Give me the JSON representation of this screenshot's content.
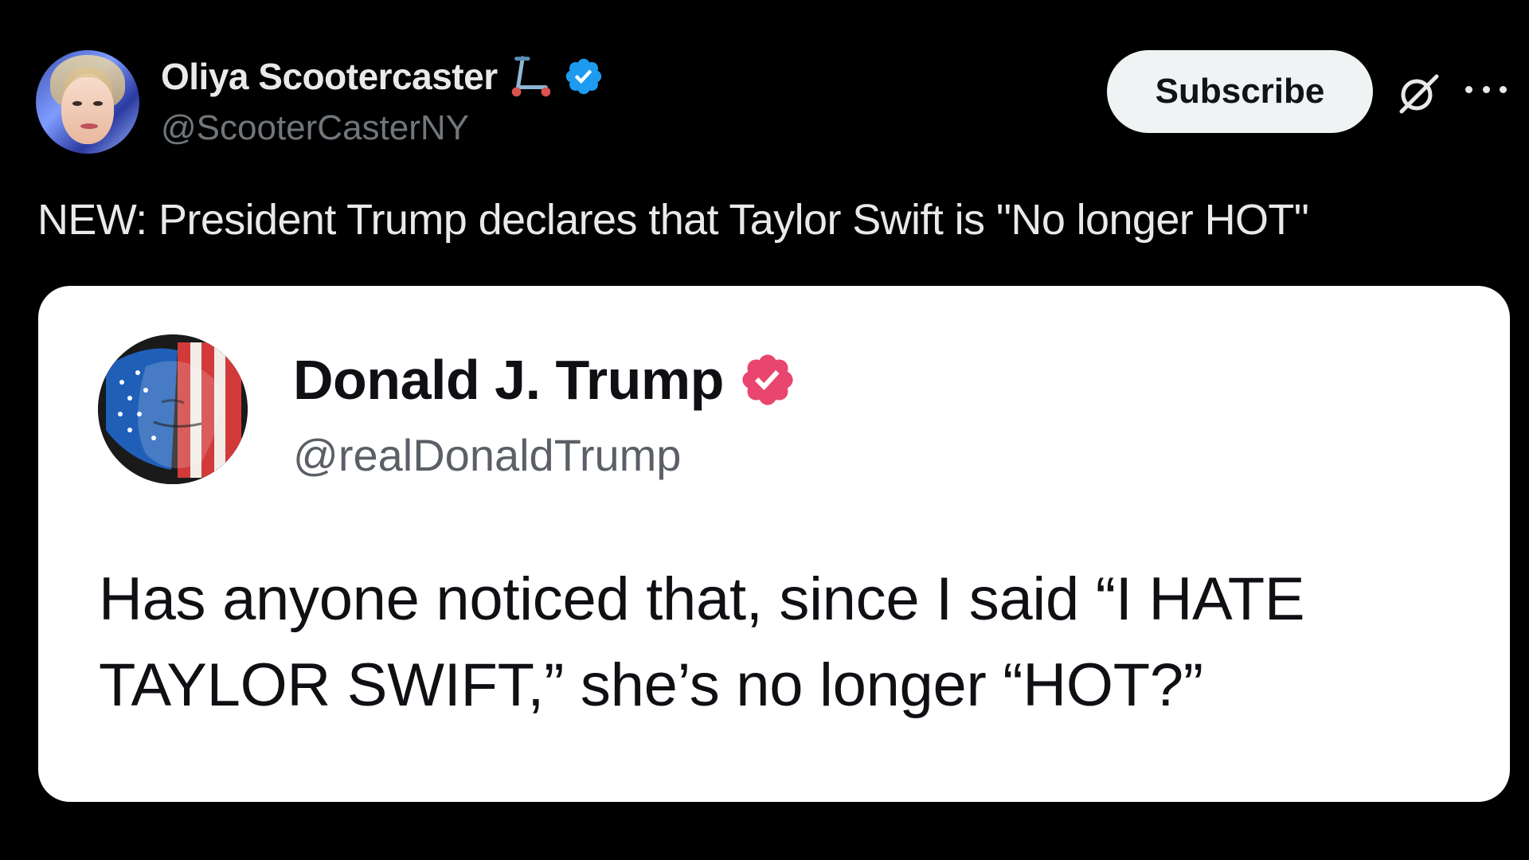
{
  "tweet": {
    "author": {
      "display_name": "Oliya Scootercaster",
      "handle": "@ScooterCasterNY",
      "emoji_icon": "kick-scooter-icon",
      "verified_badge": "verified-blue-icon"
    },
    "subscribe_label": "Subscribe",
    "text": "NEW: President Trump declares that Taylor Swift is \"No longer HOT\""
  },
  "quoted_post": {
    "display_name": "Donald J. Trump",
    "handle": "@realDonaldTrump",
    "verified_badge": "verified-pink-icon",
    "body": "Has anyone noticed that, since I said “I HATE TAYLOR SWIFT,” she’s no longer “HOT?”"
  },
  "colors": {
    "background": "#000000",
    "primary_text": "#e7e9ea",
    "secondary_text": "#71767b",
    "verified_blue": "#1d9bf0",
    "verified_pink": "#e8466e",
    "card_background": "#ffffff"
  }
}
